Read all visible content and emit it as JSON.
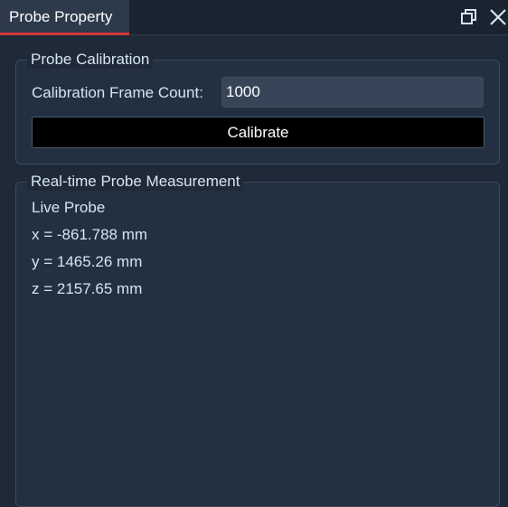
{
  "panel": {
    "tab_title": "Probe Property"
  },
  "icons": {
    "float": "float-window-icon",
    "close": "close-icon"
  },
  "calibration": {
    "group_title": "Probe Calibration",
    "frame_count_label": "Calibration Frame Count:",
    "frame_count_value": "1000",
    "calibrate_label": "Calibrate"
  },
  "measurement": {
    "group_title": "Real-time Probe Measurement",
    "probe_name": "Live Probe",
    "x": "x = -861.788 mm",
    "y": "y = 1465.26 mm",
    "z": "z = 2157.65 mm"
  },
  "colors": {
    "background": "#1f2a38",
    "tab_background": "#2c3a4b",
    "tab_underline": "#d23a3a",
    "input_background": "#364658",
    "button_background": "#000000"
  }
}
